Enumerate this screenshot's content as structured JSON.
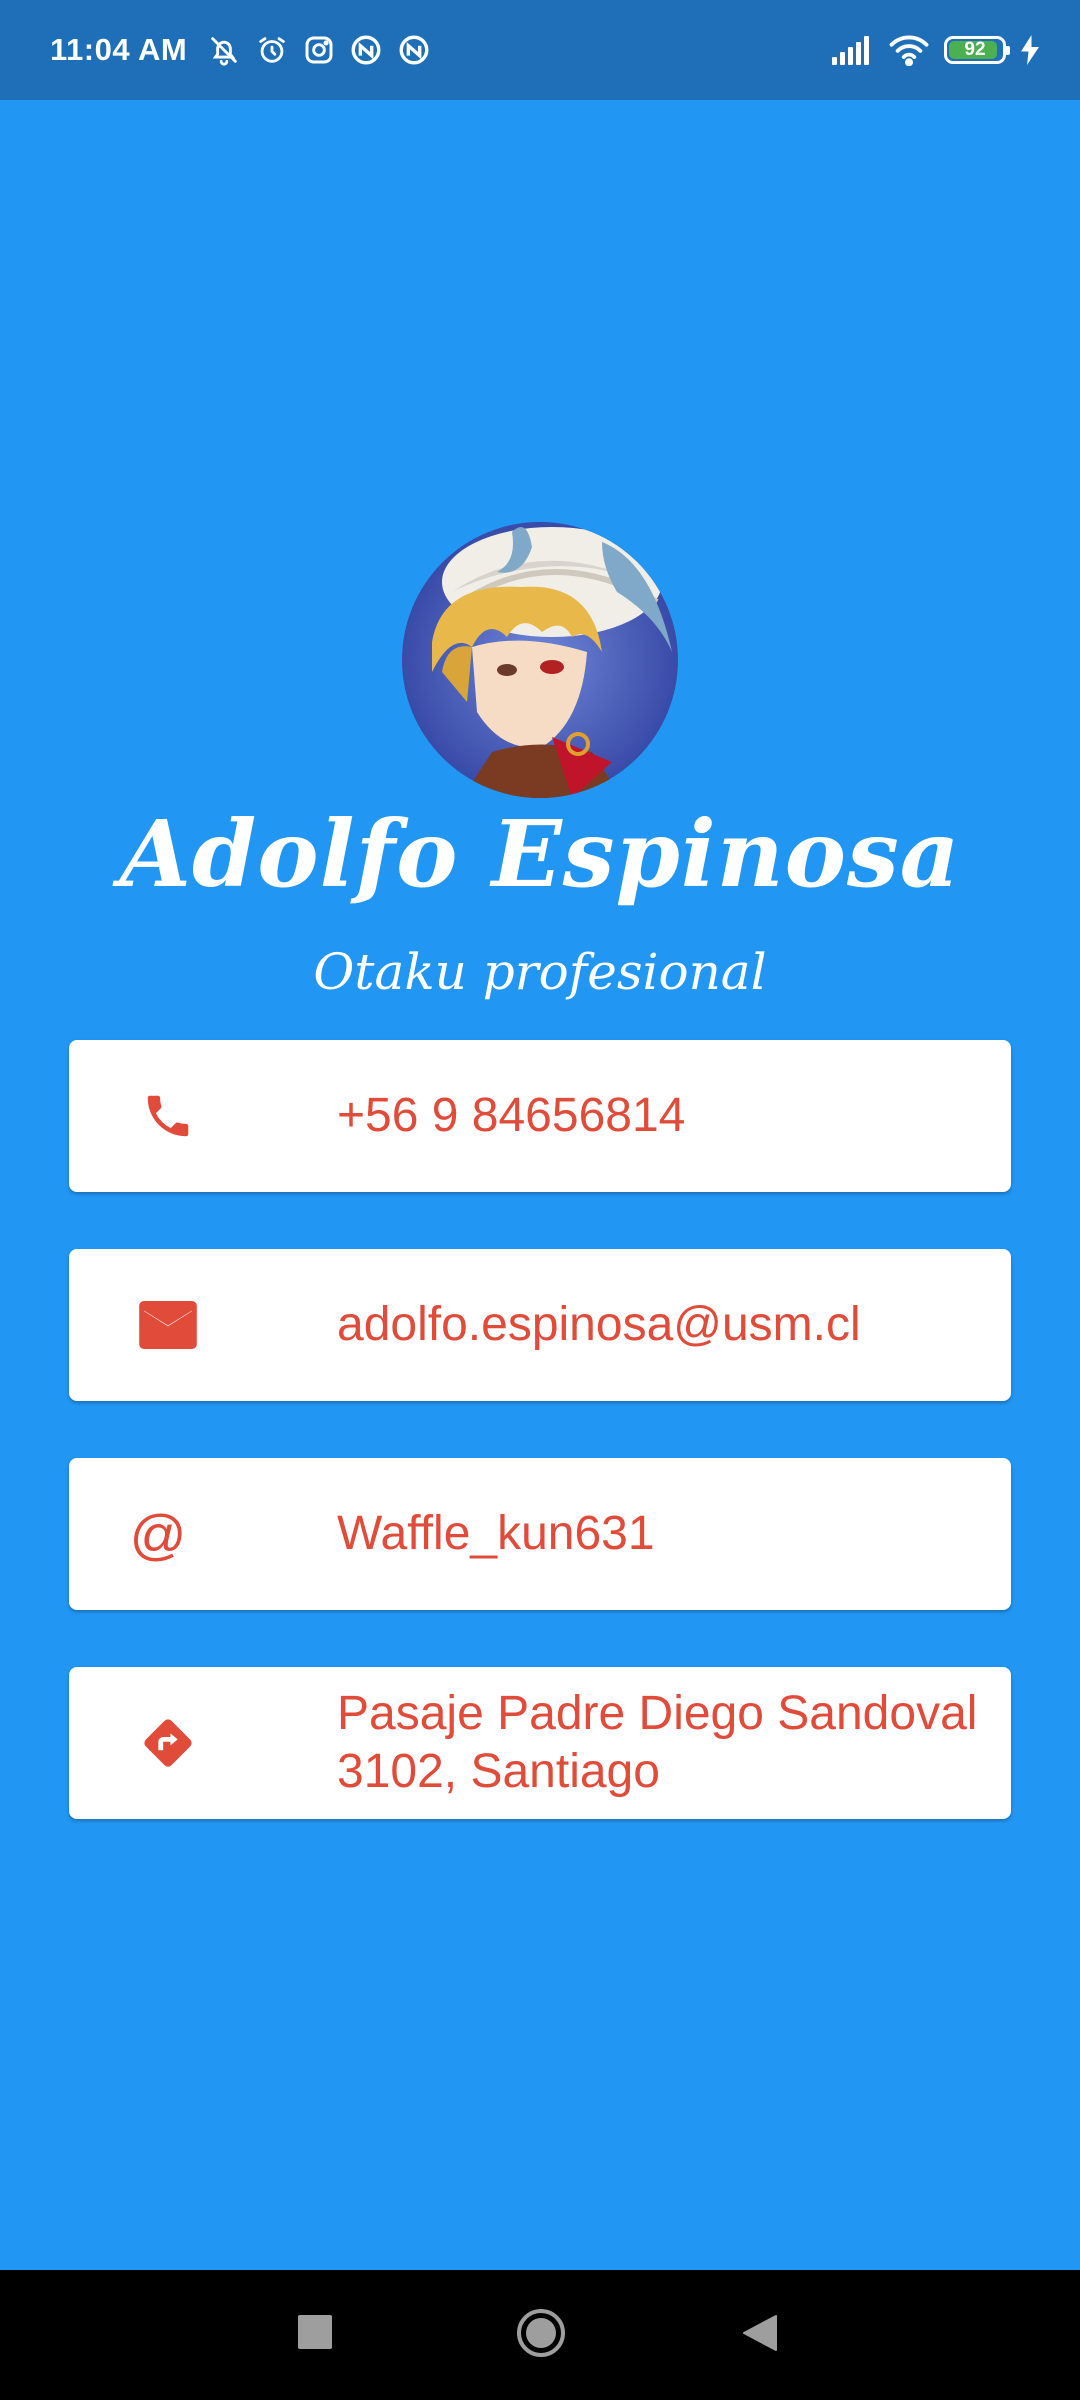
{
  "status_bar": {
    "time": "11:04 AM",
    "battery_level": "92",
    "battery_fraction": 0.92,
    "icons_left": [
      "mute-notifications-icon",
      "alarm-icon",
      "instagram-icon",
      "vpn-icon",
      "vpn-icon"
    ],
    "icons_right": [
      "signal-icon",
      "wifi-icon",
      "battery-icon",
      "charging-icon"
    ]
  },
  "profile": {
    "name": "Adolfo Espinosa",
    "subtitle": "Otaku profesional"
  },
  "contacts": [
    {
      "icon": "phone-icon",
      "text": "+56 9 84656814"
    },
    {
      "icon": "email-icon",
      "text": "adolfo.espinosa@usm.cl"
    },
    {
      "icon": "at-sign-icon",
      "glyph": "@",
      "text": "Waffle_kun631"
    },
    {
      "icon": "directions-icon",
      "text": "Pasaje Padre Diego Sandoval 3102, Santiago"
    }
  ],
  "nav_bar": {
    "buttons": [
      "recents-button",
      "home-button",
      "back-button"
    ]
  },
  "colors": {
    "background": "#2196F3",
    "status_bar": "#1E6FB8",
    "accent_text": "#E04B3A",
    "card": "#FFFFFF",
    "battery_fill": "#4CAF50",
    "nav_bar": "#000000"
  }
}
